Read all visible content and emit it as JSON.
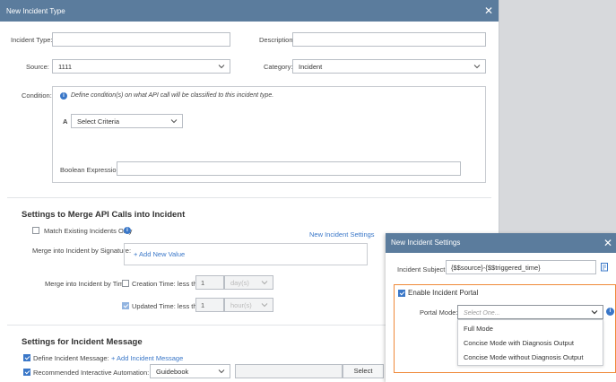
{
  "main_dialog": {
    "title": "New Incident Type",
    "incident_type_label": "Incident Type:",
    "description_label": "Description:",
    "source_label": "Source:",
    "source_value": "1111",
    "category_label": "Category:",
    "category_value": "Incident",
    "condition_label": "Condition:",
    "condition_hint": "Define condition(s) on what API call will be classified to this incident type.",
    "criteria_letter": "A",
    "criteria_placeholder": "Select Criteria",
    "boolean_label": "Boolean Expression:",
    "merge_heading": "Settings to Merge API Calls into Incident",
    "match_existing_label": "Match Existing Incidents Only",
    "new_incident_settings_link": "New Incident Settings",
    "merge_signature_label": "Merge into Incident by Signature:",
    "add_new_value": "+ Add New Value",
    "merge_time_label": "Merge into Incident by Time:",
    "creation_time_label": "Creation Time: less then",
    "creation_value": "1",
    "creation_unit": "day(s)",
    "updated_time_label": "Updated Time: less then",
    "updated_value": "1",
    "updated_unit": "hour(s)",
    "message_heading": "Settings for Incident Message",
    "define_message_label": "Define Incident Message:",
    "add_incident_message": "+ Add Incident Message",
    "recommended_label": "Recommended Interactive Automation:",
    "guidebook_value": "Guidebook",
    "select_button": "Select"
  },
  "settings_dialog": {
    "title": "New Incident Settings",
    "subject_label": "Incident Subject:",
    "subject_value": "{$$source}-{$$triggered_time}",
    "enable_portal_label": "Enable Incident Portal",
    "portal_mode_label": "Portal Mode:",
    "portal_mode_placeholder": "Select One...",
    "portal_mode_options": [
      "Full Mode",
      "Concise Mode with Diagnosis Output",
      "Concise Mode without Diagnosis Output"
    ]
  },
  "colors": {
    "titlebar": "#5b7c9d",
    "accent": "#3a77c8",
    "highlight": "#ef8a3a"
  }
}
